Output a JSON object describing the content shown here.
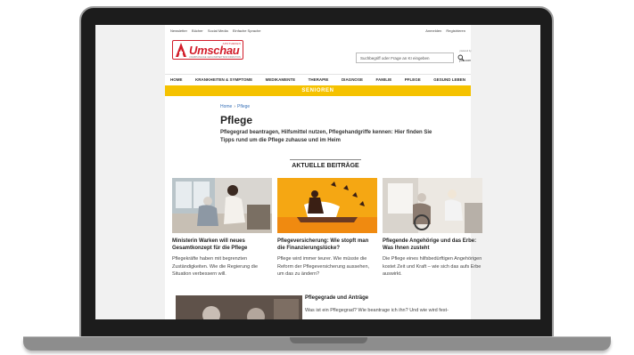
{
  "topbar": {
    "left": [
      "Newsletter",
      "Bücher",
      "Social Media",
      "Einfache Sprache"
    ],
    "right": [
      "Anmelden",
      "Registrieren"
    ]
  },
  "logo": {
    "top": "APOTHEKEN",
    "name": "Umschau",
    "sub": "UNABHÄNGIGE GESUNDHEITSINFORMATION"
  },
  "search": {
    "placeholder": "Suchbegriff oder Frage an KI eingeben",
    "powered_label": "powered by",
    "provider": "you.com"
  },
  "nav": [
    "HOME",
    "KRANKHEITEN & SYMPTOME",
    "MEDIKAMENTE",
    "THERAPIE",
    "DIAGNOSE",
    "FAMILIE",
    "PFLEGE",
    "GESUND LEBEN"
  ],
  "senioren": "SENIOREN",
  "breadcrumb": {
    "home": "Home",
    "current": "Pflege"
  },
  "page": {
    "title": "Pflege",
    "intro": "Pflegegrad beantragen, Hilfsmittel nutzen, Pflegehandgriffe kennen: Hier finden Sie Tipps rund um die Pflege zuhause und im Heim"
  },
  "section_title": "AKTUELLE BEITRÄGE",
  "cards": [
    {
      "title": "Ministerin Warken will neues Gesamtkonzept für die Pflege",
      "text": "Pflegekräfte haben mit begrenzten Zuständigkeiten. Wie die Regierung die Situation verbessern will."
    },
    {
      "title": "Pflegeversicherung: Wie stopft man die Finanzierungslücke?",
      "text": "Pflege wird immer teurer. Wie müsste die Reform der Pflegeversicherung aussehen, um das zu ändern?"
    },
    {
      "title": "Pflegende Angehörige und das Erbe: Was Ihnen zusteht",
      "text": "Die Pflege eines hilfsbedürftigen Angehörigen kostet Zeit und Kraft – wie sich das aufs Erbe auswirkt."
    }
  ],
  "bottom": {
    "title": "Pflegegrade und Anträge",
    "text": "Was ist ein Pflegegrad? Wie beantrage ich ihn? Und wie wird fest-"
  },
  "colors": {
    "brand_red": "#d21d2a",
    "senior_yellow": "#f5c200",
    "link_blue": "#3a72b8"
  }
}
